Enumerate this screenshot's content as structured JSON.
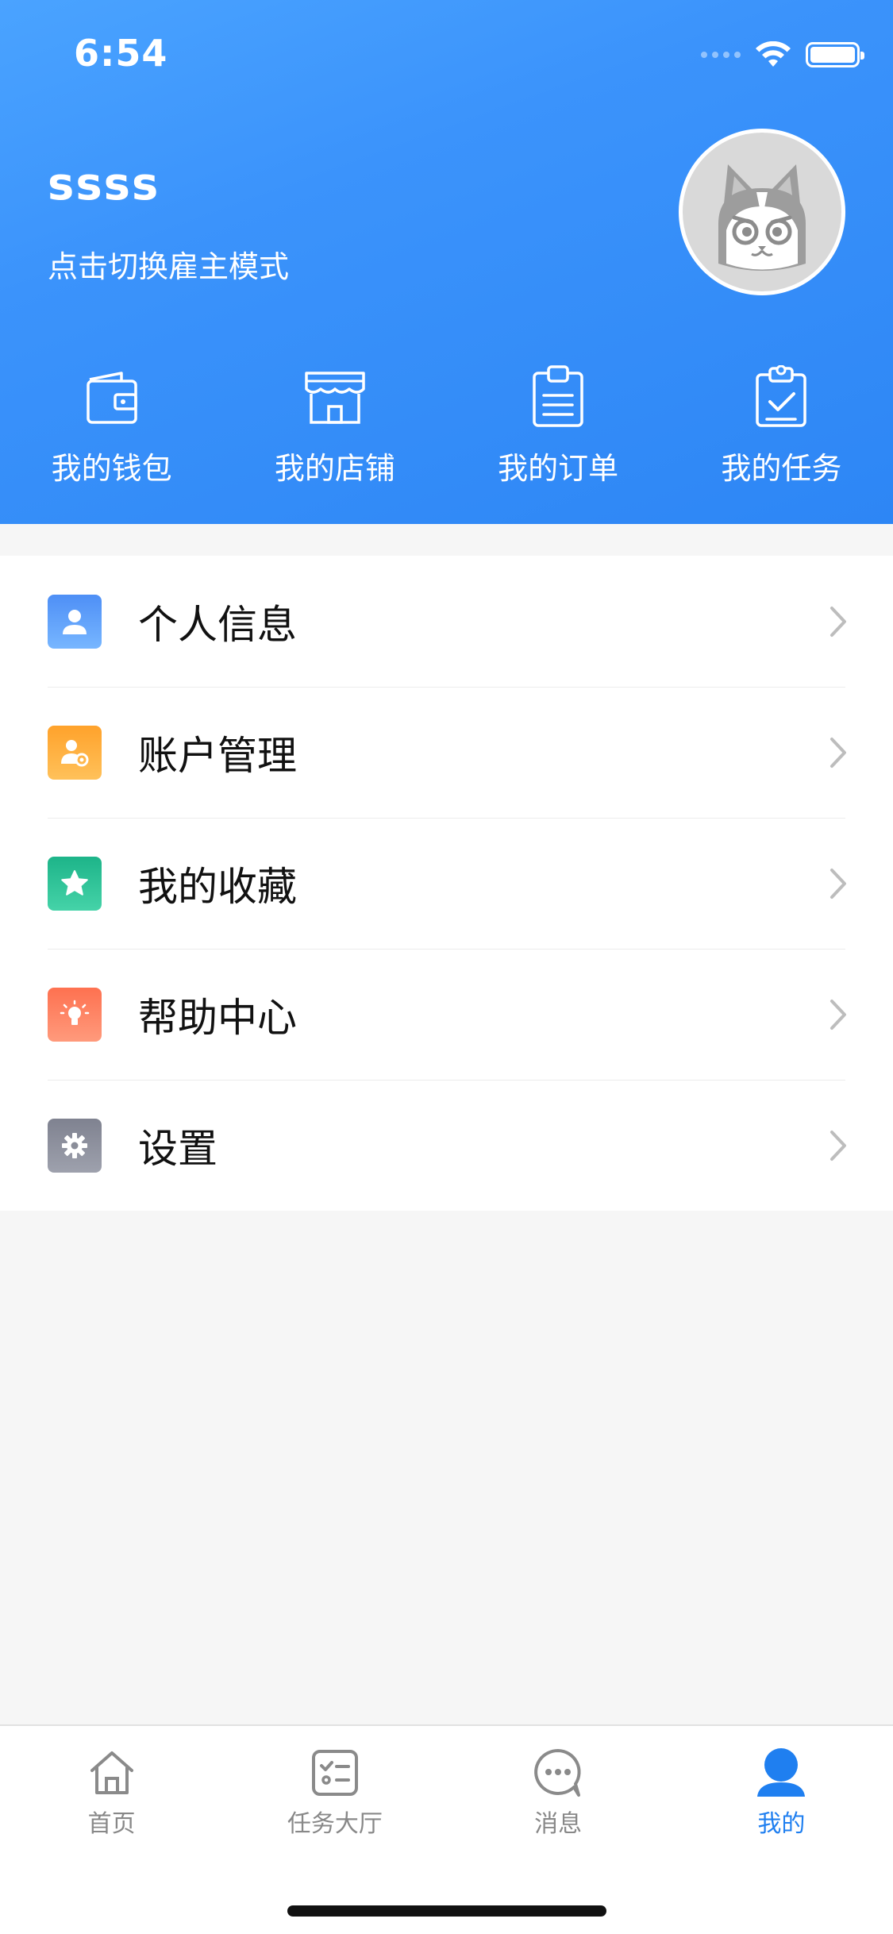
{
  "status_bar": {
    "time": "6:54"
  },
  "profile": {
    "username": "ssss",
    "switch_mode_text": "点击切换雇主模式"
  },
  "quick_actions": [
    {
      "label": "我的钱包",
      "icon": "wallet-icon"
    },
    {
      "label": "我的店铺",
      "icon": "store-icon"
    },
    {
      "label": "我的订单",
      "icon": "orders-icon"
    },
    {
      "label": "我的任务",
      "icon": "tasks-icon"
    }
  ],
  "menu": [
    {
      "label": "个人信息",
      "icon": "person-icon",
      "color_from": "#4e8ff6",
      "color_to": "#77b6ff"
    },
    {
      "label": "账户管理",
      "icon": "account-manage-icon",
      "color_from": "#ffa22b",
      "color_to": "#ffc15a"
    },
    {
      "label": "我的收藏",
      "icon": "star-icon",
      "color_from": "#1db489",
      "color_to": "#45d3a8"
    },
    {
      "label": "帮助中心",
      "icon": "lightbulb-icon",
      "color_from": "#fe7150",
      "color_to": "#ff9a7c"
    },
    {
      "label": "设置",
      "icon": "gear-icon",
      "color_from": "#7f8290",
      "color_to": "#9ea1ad"
    }
  ],
  "tabbar": {
    "tabs": [
      {
        "label": "首页",
        "icon": "home-icon",
        "active": false
      },
      {
        "label": "任务大厅",
        "icon": "task-hall-icon",
        "active": false
      },
      {
        "label": "消息",
        "icon": "message-icon",
        "active": false
      },
      {
        "label": "我的",
        "icon": "user-icon",
        "active": true
      }
    ]
  },
  "colors": {
    "header_blue": "#3b93fb",
    "active_tab": "#1f7ff0",
    "inactive_tab": "#888888"
  }
}
